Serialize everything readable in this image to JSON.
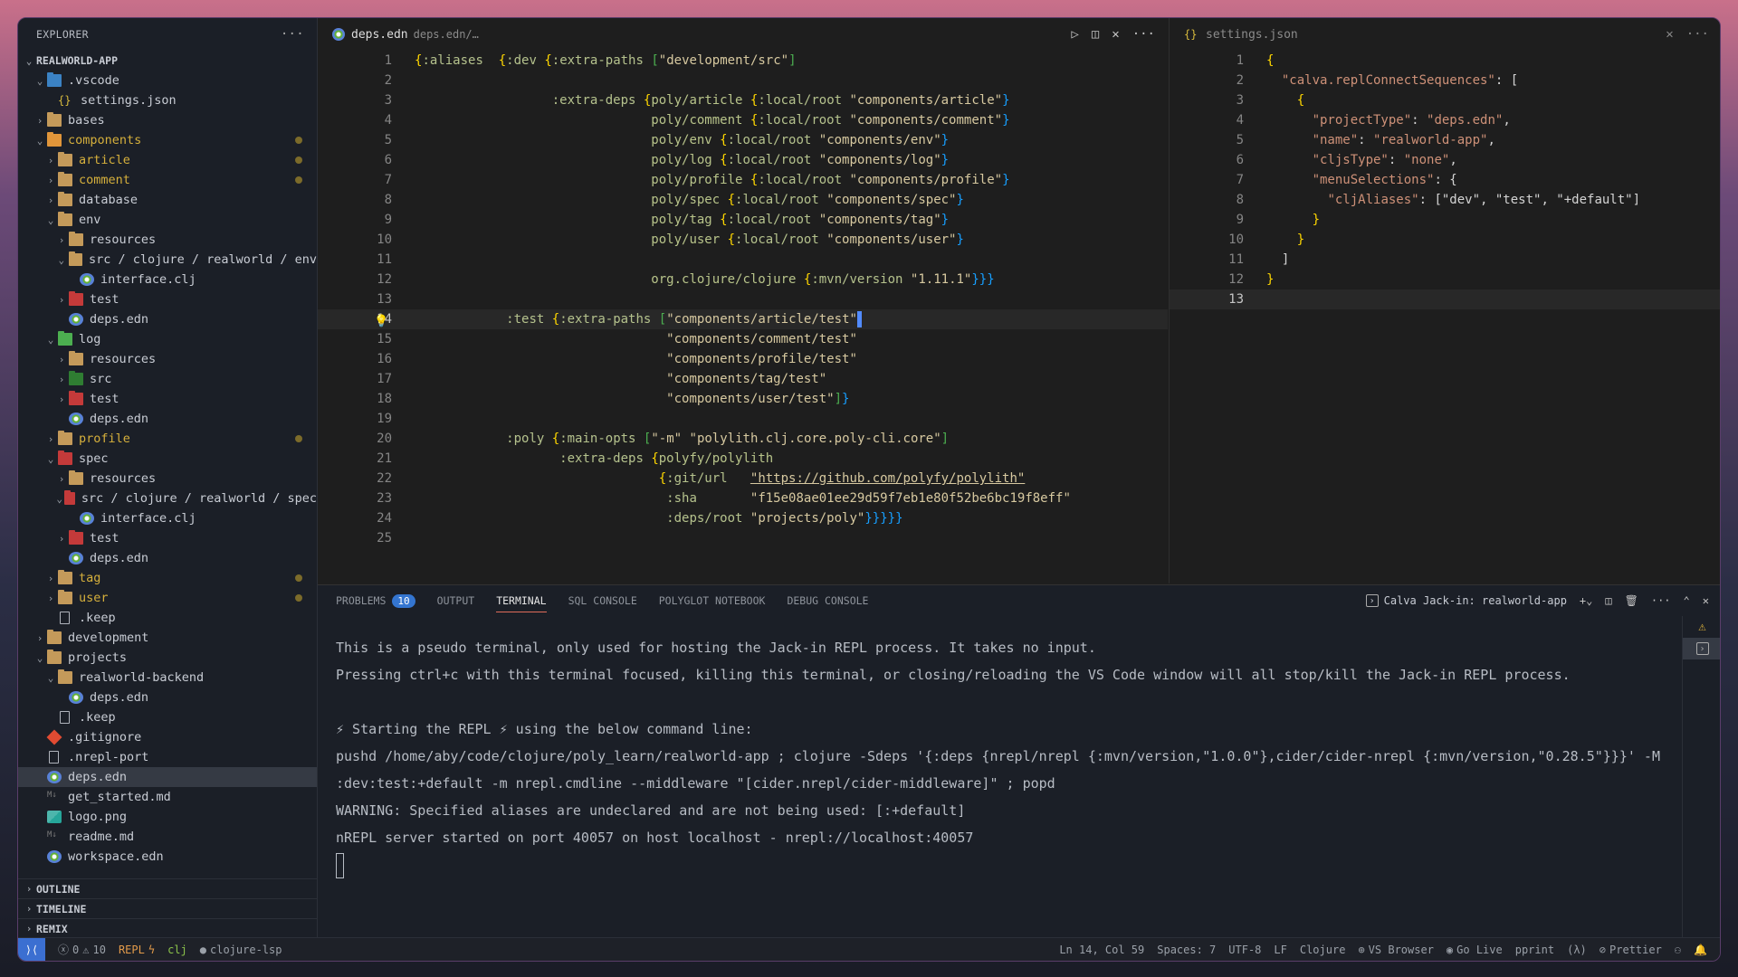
{
  "explorer": {
    "title": "EXPLORER",
    "more": "···",
    "root": "REALWORLD-APP",
    "items": [
      {
        "label": ".vscode",
        "depth": 1,
        "type": "folder",
        "color": "blue",
        "open": true
      },
      {
        "label": "settings.json",
        "depth": 2,
        "type": "json"
      },
      {
        "label": "bases",
        "depth": 1,
        "type": "folder",
        "open": false
      },
      {
        "label": "components",
        "depth": 1,
        "type": "folder",
        "color": "orange",
        "open": true,
        "modified": true
      },
      {
        "label": "article",
        "depth": 2,
        "type": "folder",
        "open": false,
        "modified": true
      },
      {
        "label": "comment",
        "depth": 2,
        "type": "folder",
        "open": false,
        "modified": true
      },
      {
        "label": "database",
        "depth": 2,
        "type": "folder",
        "open": false
      },
      {
        "label": "env",
        "depth": 2,
        "type": "folder",
        "open": true
      },
      {
        "label": "resources",
        "depth": 3,
        "type": "folder",
        "open": false
      },
      {
        "label": "src / clojure / realworld / env",
        "depth": 3,
        "type": "folder",
        "open": true
      },
      {
        "label": "interface.clj",
        "depth": 4,
        "type": "clj"
      },
      {
        "label": "test",
        "depth": 3,
        "type": "folder",
        "color": "red",
        "open": false
      },
      {
        "label": "deps.edn",
        "depth": 3,
        "type": "clj"
      },
      {
        "label": "log",
        "depth": 2,
        "type": "folder",
        "color": "green",
        "open": true
      },
      {
        "label": "resources",
        "depth": 3,
        "type": "folder",
        "open": false
      },
      {
        "label": "src",
        "depth": 3,
        "type": "folder",
        "color": "darkgreen",
        "open": false
      },
      {
        "label": "test",
        "depth": 3,
        "type": "folder",
        "color": "red",
        "open": false
      },
      {
        "label": "deps.edn",
        "depth": 3,
        "type": "clj"
      },
      {
        "label": "profile",
        "depth": 2,
        "type": "folder",
        "open": false,
        "modified": true
      },
      {
        "label": "spec",
        "depth": 2,
        "type": "folder",
        "color": "red",
        "open": true
      },
      {
        "label": "resources",
        "depth": 3,
        "type": "folder",
        "open": false
      },
      {
        "label": "src / clojure / realworld / spec",
        "depth": 3,
        "type": "folder",
        "color": "red",
        "open": true
      },
      {
        "label": "interface.clj",
        "depth": 4,
        "type": "clj"
      },
      {
        "label": "test",
        "depth": 3,
        "type": "folder",
        "color": "red",
        "open": false
      },
      {
        "label": "deps.edn",
        "depth": 3,
        "type": "clj"
      },
      {
        "label": "tag",
        "depth": 2,
        "type": "folder",
        "open": false,
        "modified": true
      },
      {
        "label": "user",
        "depth": 2,
        "type": "folder",
        "open": false,
        "modified": true
      },
      {
        "label": ".keep",
        "depth": 2,
        "type": "file"
      },
      {
        "label": "development",
        "depth": 1,
        "type": "folder",
        "open": false
      },
      {
        "label": "projects",
        "depth": 1,
        "type": "folder",
        "open": true
      },
      {
        "label": "realworld-backend",
        "depth": 2,
        "type": "folder",
        "open": true
      },
      {
        "label": "deps.edn",
        "depth": 3,
        "type": "clj"
      },
      {
        "label": ".keep",
        "depth": 2,
        "type": "file"
      },
      {
        "label": ".gitignore",
        "depth": 1,
        "type": "git"
      },
      {
        "label": ".nrepl-port",
        "depth": 1,
        "type": "file"
      },
      {
        "label": "deps.edn",
        "depth": 1,
        "type": "clj",
        "selected": true
      },
      {
        "label": "get_started.md",
        "depth": 1,
        "type": "md"
      },
      {
        "label": "logo.png",
        "depth": 1,
        "type": "img"
      },
      {
        "label": "readme.md",
        "depth": 1,
        "type": "md"
      },
      {
        "label": "workspace.edn",
        "depth": 1,
        "type": "clj"
      }
    ],
    "sections": [
      "OUTLINE",
      "TIMELINE",
      "REMIX"
    ]
  },
  "editor_left": {
    "tab_label": "deps.edn",
    "tab_path": "deps.edn/…",
    "current_line": 14,
    "lines": [
      "{:aliases  {:dev {:extra-paths [\"development/src\"]",
      "",
      "                  :extra-deps {poly/article {:local/root \"components/article\"}",
      "                               poly/comment {:local/root \"components/comment\"}",
      "                               poly/env {:local/root \"components/env\"}",
      "                               poly/log {:local/root \"components/log\"}",
      "                               poly/profile {:local/root \"components/profile\"}",
      "                               poly/spec {:local/root \"components/spec\"}",
      "                               poly/tag {:local/root \"components/tag\"}",
      "                               poly/user {:local/root \"components/user\"}",
      "",
      "                               org.clojure/clojure {:mvn/version \"1.11.1\"}}}",
      "",
      "            :test {:extra-paths [\"components/article/test\"",
      "                                 \"components/comment/test\"",
      "                                 \"components/profile/test\"",
      "                                 \"components/tag/test\"",
      "                                 \"components/user/test\"]}",
      "",
      "            :poly {:main-opts [\"-m\" \"polylith.clj.core.poly-cli.core\"]",
      "                   :extra-deps {polyfy/polylith",
      "                                {:git/url   \"https://github.com/polyfy/polylith\"",
      "                                 :sha       \"f15e08ae01ee29d59f7eb1e80f52be6bc19f8eff\"",
      "                                 :deps/root \"projects/poly\"}}}}}",
      ""
    ]
  },
  "editor_right": {
    "tab_label": "settings.json",
    "current_line": 13,
    "lines": [
      "{",
      "  \"calva.replConnectSequences\": [",
      "    {",
      "      \"projectType\": \"deps.edn\",",
      "      \"name\": \"realworld-app\",",
      "      \"cljsType\": \"none\",",
      "      \"menuSelections\": {",
      "        \"cljAliases\": [\"dev\", \"test\", \"+default\"]",
      "      }",
      "    }",
      "  ]",
      "}",
      ""
    ]
  },
  "panel": {
    "tabs": [
      {
        "label": "PROBLEMS",
        "badge": "10"
      },
      {
        "label": "OUTPUT"
      },
      {
        "label": "TERMINAL",
        "active": true
      },
      {
        "label": "SQL CONSOLE"
      },
      {
        "label": "POLYGLOT NOTEBOOK"
      },
      {
        "label": "DEBUG CONSOLE"
      }
    ],
    "terminal_name": "Calva Jack-in: realworld-app",
    "terminal_lines": [
      "This is a pseudo terminal, only used for hosting the Jack-in REPL process. It takes no input.",
      "Pressing ctrl+c with this terminal focused, killing this terminal, or closing/reloading the VS Code window will all stop/kill the Jack-in REPL process.",
      "",
      "⚡ Starting the REPL ⚡ using the below command line:",
      "pushd /home/aby/code/clojure/poly_learn/realworld-app ; clojure -Sdeps '{:deps {nrepl/nrepl {:mvn/version,\"1.0.0\"},cider/cider-nrepl {:mvn/version,\"0.28.5\"}}}' -M",
      ":dev:test:+default -m nrepl.cmdline --middleware \"[cider.nrepl/cider-middleware]\" ; popd",
      "WARNING: Specified aliases are undeclared and are not being used: [:+default]",
      "nREPL server started on port 40057 on host localhost - nrepl://localhost:40057"
    ]
  },
  "statusbar": {
    "errors": "0",
    "warnings": "10",
    "repl": "REPL",
    "clj": "clj",
    "lsp": "clojure-lsp",
    "position": "Ln 14, Col 59",
    "spaces": "Spaces: 7",
    "encoding": "UTF-8",
    "eol": "LF",
    "language": "Clojure",
    "vs_browser": "VS Browser",
    "go_live": "Go Live",
    "pprint": "pprint",
    "lambda": "(λ)",
    "prettier": "Prettier"
  }
}
